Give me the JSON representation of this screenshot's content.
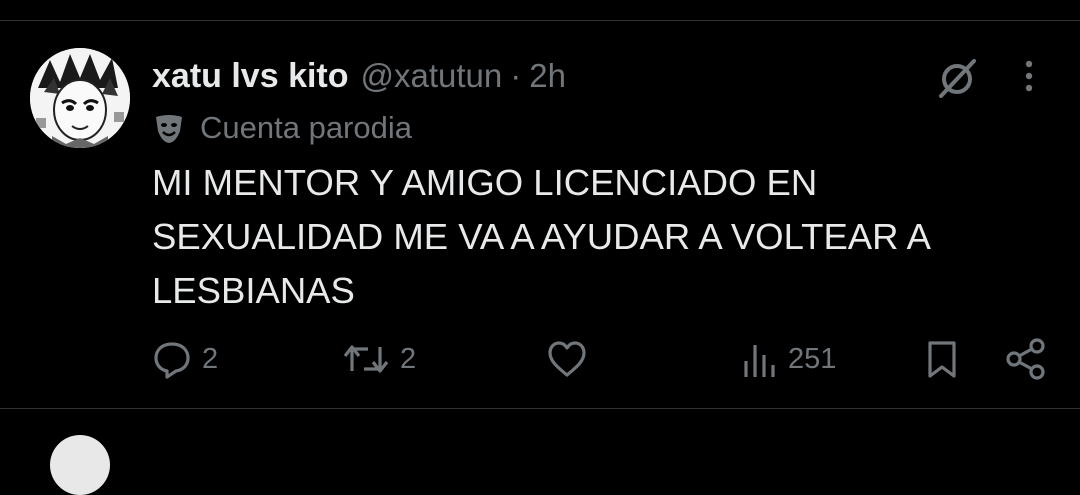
{
  "tweet": {
    "author_name": "xatu lvs kito",
    "handle": "@xatutun",
    "separator": "·",
    "time": "2h",
    "parody_label": "Cuenta parodia",
    "text_lines": [
      "MI MENTOR Y AMIGO LICENCIADO EN",
      "SEXUALIDAD ME VA A AYUDAR A VOLTEAR A",
      "LESBIANAS"
    ]
  },
  "actions": {
    "replies": "2",
    "reposts": "2",
    "views": "251"
  },
  "icons": [
    "avatar",
    "grok-icon",
    "more-icon",
    "parody-mask-icon",
    "reply-icon",
    "repost-icon",
    "like-icon",
    "views-icon",
    "bookmark-icon",
    "share-icon"
  ],
  "colors": {
    "background": "#000000",
    "primary_text": "#e7e9ea",
    "secondary_text": "#71767b",
    "divider": "#2f3336"
  }
}
